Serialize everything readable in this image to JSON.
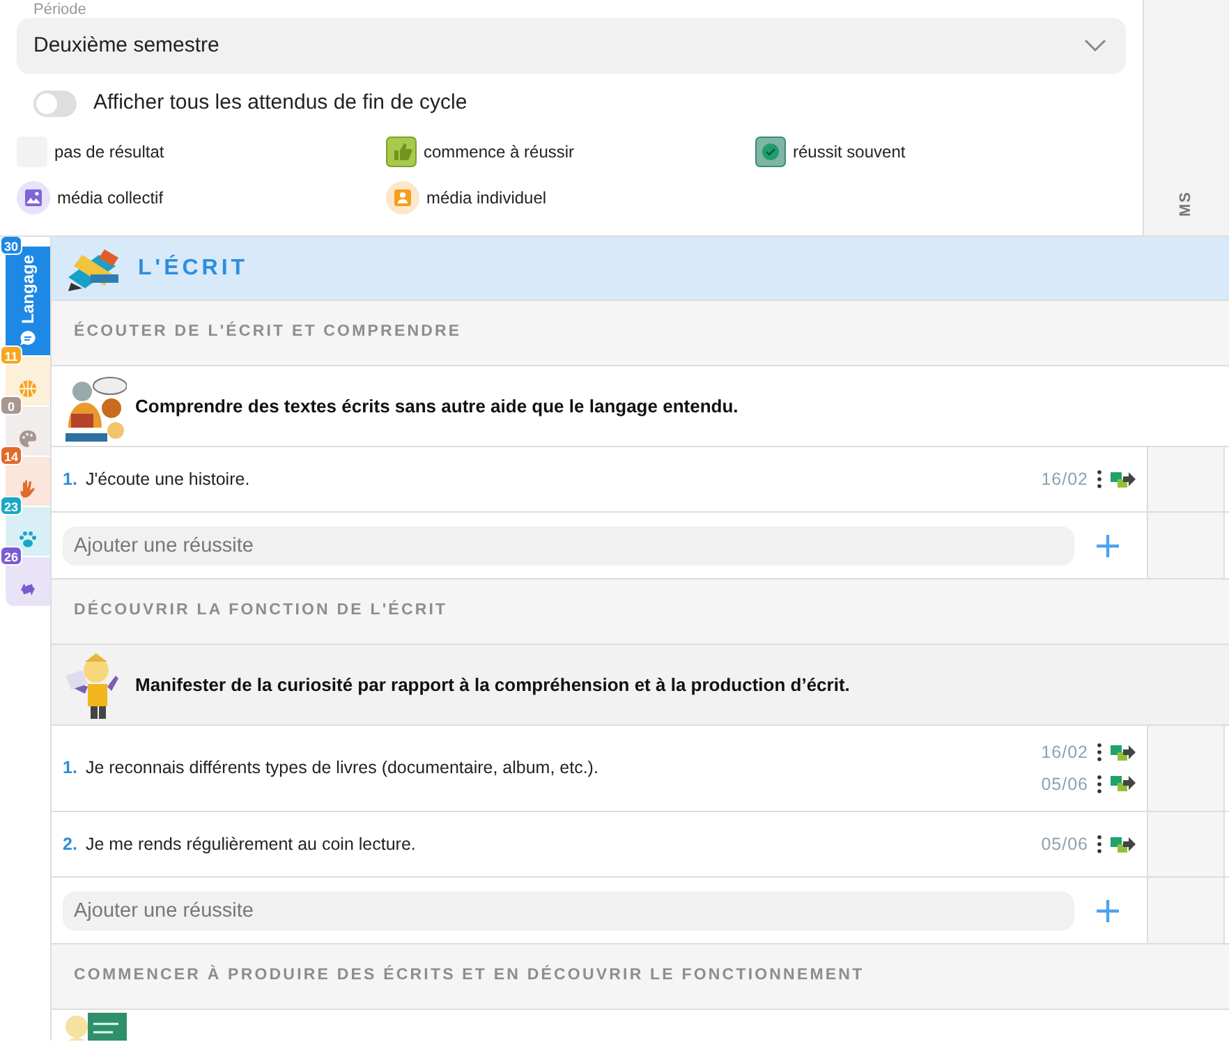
{
  "period": {
    "label": "Période",
    "value": "Deuxième semestre"
  },
  "toggle": {
    "label": "Afficher tous les attendus de fin de cycle",
    "on": false
  },
  "legend": [
    {
      "kind": "none",
      "label": "pas de résultat"
    },
    {
      "kind": "started",
      "label": "commence à réussir"
    },
    {
      "kind": "often",
      "label": "réussit souvent"
    },
    {
      "kind": "media_collective",
      "label": "média collectif"
    },
    {
      "kind": "media_individual",
      "label": "média individuel"
    }
  ],
  "level_column": {
    "label": "MS"
  },
  "domain_tabs": [
    {
      "label": "Langage",
      "count": "30",
      "color": "#1e88e5",
      "selected": true
    },
    {
      "count": "11",
      "color": "#f5a623",
      "selected": false
    },
    {
      "count": "0",
      "color": "#a8968f",
      "selected": false
    },
    {
      "count": "14",
      "color": "#e06a2c",
      "selected": false
    },
    {
      "count": "23",
      "color": "#19a8c4",
      "selected": false
    },
    {
      "count": "26",
      "color": "#7b5bd3",
      "selected": false
    }
  ],
  "domain": {
    "title": "L'ÉCRIT"
  },
  "sections": [
    {
      "title": "ÉCOUTER DE L'ÉCRIT ET COMPRENDRE",
      "objectives": [
        {
          "text": "Comprendre des textes écrits sans autre aide que le langage entendu.",
          "hovered": false,
          "items": [
            {
              "number": "1.",
              "text": "J'écoute une histoire.",
              "dates": [
                "16/02"
              ]
            }
          ],
          "add_placeholder": "Ajouter une réussite"
        }
      ]
    },
    {
      "title": "DÉCOUVRIR LA FONCTION DE L'ÉCRIT",
      "objectives": [
        {
          "text": "Manifester de la curiosité par rapport à la compréhension et à la production d’écrit.",
          "hovered": true,
          "items": [
            {
              "number": "1.",
              "text": "Je reconnais différents types de livres (documentaire, album, etc.).",
              "dates": [
                "16/02",
                "05/06"
              ]
            },
            {
              "number": "2.",
              "text": "Je me rends régulièrement au coin lecture.",
              "dates": [
                "05/06"
              ]
            }
          ],
          "add_placeholder": "Ajouter une réussite"
        }
      ]
    },
    {
      "title": "COMMENCER À PRODUIRE DES ÉCRITS ET EN DÉCOUVRIR LE FONCTIONNEMENT"
    }
  ]
}
